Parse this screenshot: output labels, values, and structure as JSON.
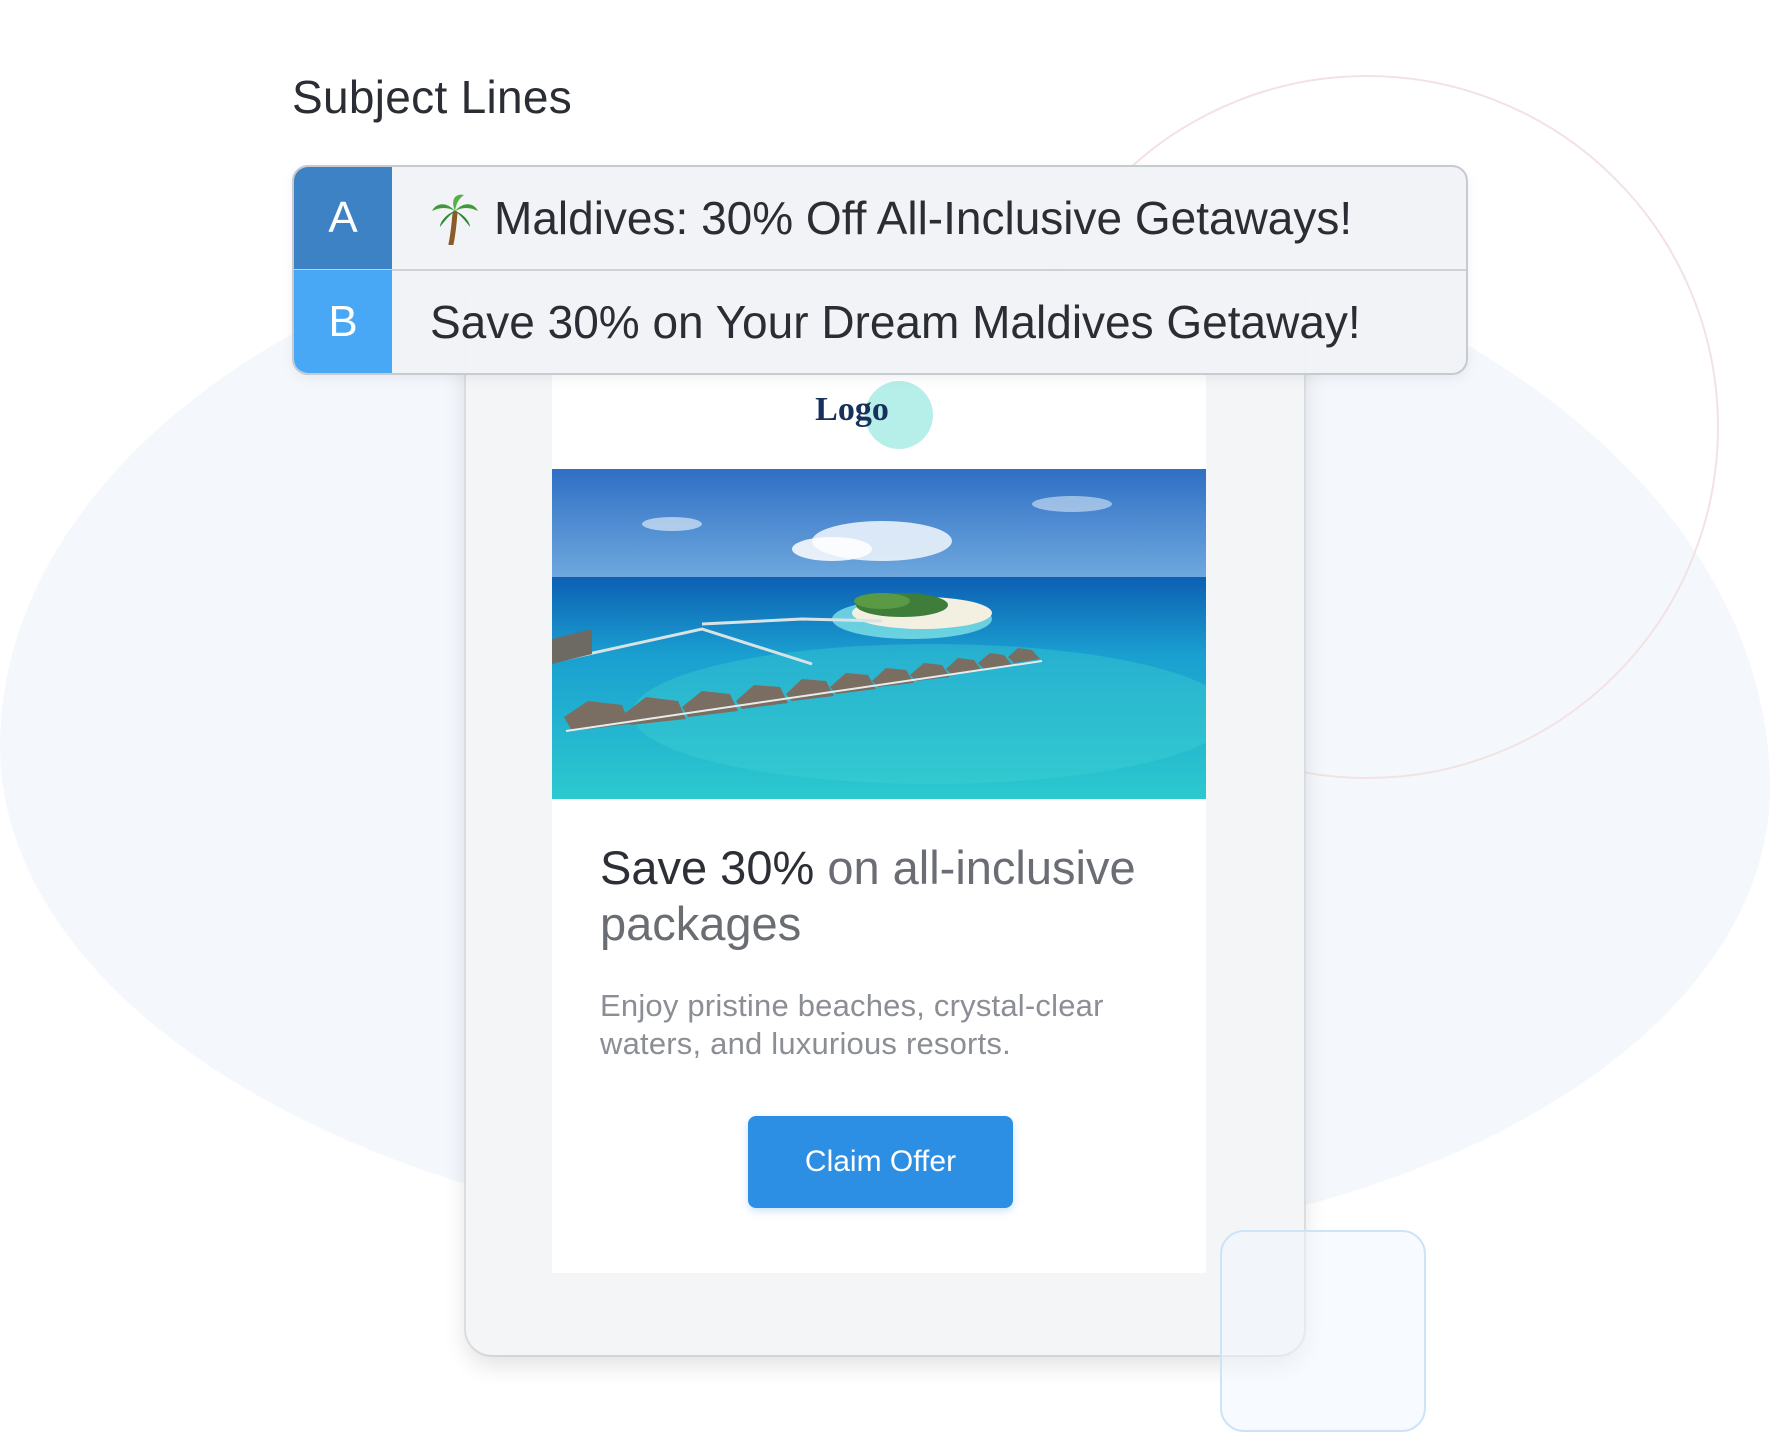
{
  "section": {
    "heading": "Subject Lines"
  },
  "subject_lines": {
    "a": {
      "badge": "A",
      "icon": "palm-tree-icon",
      "text": "Maldives: 30% Off All-Inclusive Getaways!"
    },
    "b": {
      "badge": "B",
      "text": "Save 30% on Your Dream Maldives Getaway!"
    }
  },
  "email": {
    "logo": "Logo",
    "hero_image": "maldives-overwater-villas-image",
    "headline_strong": "Save 30%",
    "headline_rest": " on all-inclusive packages",
    "body": "Enjoy pristine beaches, crystal-clear waters, and luxurious resorts.",
    "cta_label": "Claim Offer"
  },
  "colors": {
    "badge_a": "#3c82c4",
    "badge_b": "#49a8f6",
    "cta": "#2d8fe3",
    "logo_text": "#17315c",
    "logo_circle": "#b6eeea"
  }
}
